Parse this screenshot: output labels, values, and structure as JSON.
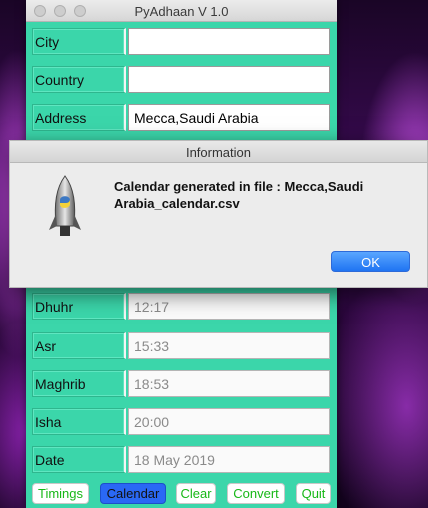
{
  "window": {
    "title": "PyAdhaan V 1.0"
  },
  "form": {
    "city": {
      "label": "City",
      "value": ""
    },
    "country": {
      "label": "Country",
      "value": ""
    },
    "address": {
      "label": "Address",
      "value": "Mecca,Saudi Arabia"
    },
    "dhuhr": {
      "label": "Dhuhr",
      "value": "12:17"
    },
    "asr": {
      "label": "Asr",
      "value": "15:33"
    },
    "maghrib": {
      "label": "Maghrib",
      "value": "18:53"
    },
    "isha": {
      "label": "Isha",
      "value": "20:00"
    },
    "date": {
      "label": "Date",
      "value": "18 May 2019"
    }
  },
  "buttons": {
    "timings": "Timings",
    "calendar": "Calendar",
    "clear": "Clear",
    "convert": "Convert",
    "quit": "Quit"
  },
  "dialog": {
    "title": "Information",
    "message": "Calendar generated in file : Mecca,Saudi Arabia_calendar.csv",
    "ok_label": "OK"
  },
  "colors": {
    "window_bg": "#3bd6aa",
    "button_text": "#17b817",
    "active_button": "#2a68f5",
    "ok_button": "#1f74f2"
  },
  "icons": {
    "dialog_icon": "python-rocket-icon"
  }
}
